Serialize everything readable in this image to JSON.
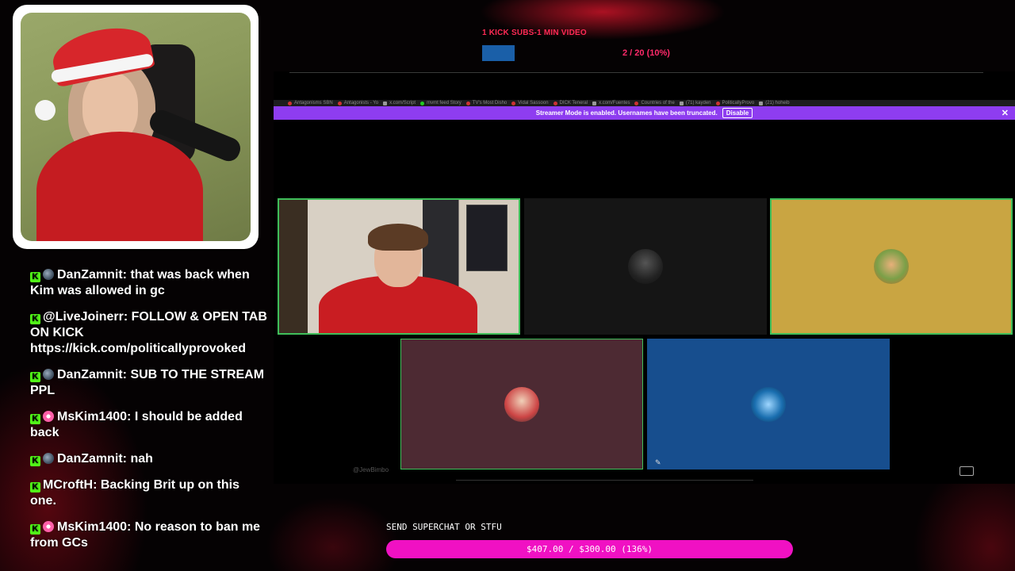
{
  "top_goal": {
    "title": "1 KICK SUBS-1 MIN VIDEO",
    "progress_text": "2 / 20 (10%)",
    "progress_fraction": 0.1
  },
  "browser": {
    "tabs": [
      {
        "label": "Antagonisms SBN",
        "icon": "youtube-icon"
      },
      {
        "label": "Antagonists - Yo",
        "icon": "youtube-icon"
      },
      {
        "label": "x.com/Script",
        "icon": "x-icon"
      },
      {
        "label": "mvmt feed Story",
        "icon": "kick-icon"
      },
      {
        "label": "TV's Most Disho",
        "icon": "youtube-icon"
      },
      {
        "label": "Vidal Sassoon",
        "icon": "youtube-icon"
      },
      {
        "label": "DICK Teneral",
        "icon": "youtube-icon"
      },
      {
        "label": "x.com/Fuentes",
        "icon": "x-icon"
      },
      {
        "label": "Countries of the",
        "icon": "web-icon"
      },
      {
        "label": "(71) kayden",
        "icon": "x-icon"
      },
      {
        "label": "PoliticallyProvo",
        "icon": "web-icon"
      },
      {
        "label": "(21) hoheib",
        "icon": "x-icon"
      }
    ],
    "streamer_banner": {
      "message": "Streamer Mode is enabled. Usernames have been truncated.",
      "disable_label": "Disable",
      "close_label": "✕"
    },
    "bottom_name": "@JewBimbo"
  },
  "chat": {
    "messages": [
      {
        "user": "DanZamnit",
        "badge": "planet",
        "text": "that was back when Kim was allowed in gc"
      },
      {
        "user": "@LiveJoinerr",
        "badge": "none",
        "text": "FOLLOW & OPEN TAB ON KICK https://kick.com/politicallyprovoked"
      },
      {
        "user": "DanZamnit",
        "badge": "planet",
        "text": "SUB TO THE STREAM PPL"
      },
      {
        "user": "MsKim1400",
        "badge": "pink",
        "text": "I should be added back"
      },
      {
        "user": "DanZamnit",
        "badge": "planet",
        "text": "nah"
      },
      {
        "user": "MCroftH",
        "badge": "none",
        "text": "Backing Brit up on this one."
      },
      {
        "user": "MsKim1400",
        "badge": "pink",
        "text": "No reason to ban me from GCs"
      }
    ]
  },
  "superchat_goal": {
    "label": "SEND SUPERCHAT OR STFU",
    "progress_text": "$407.00 / $300.00 (136%)",
    "progress_fraction": 1.36
  },
  "colors": {
    "accent_kick": "#53fc18",
    "banner_purple": "#8e3df0",
    "superchat_pink": "#f011c3",
    "goal_red": "#ff2a55"
  }
}
